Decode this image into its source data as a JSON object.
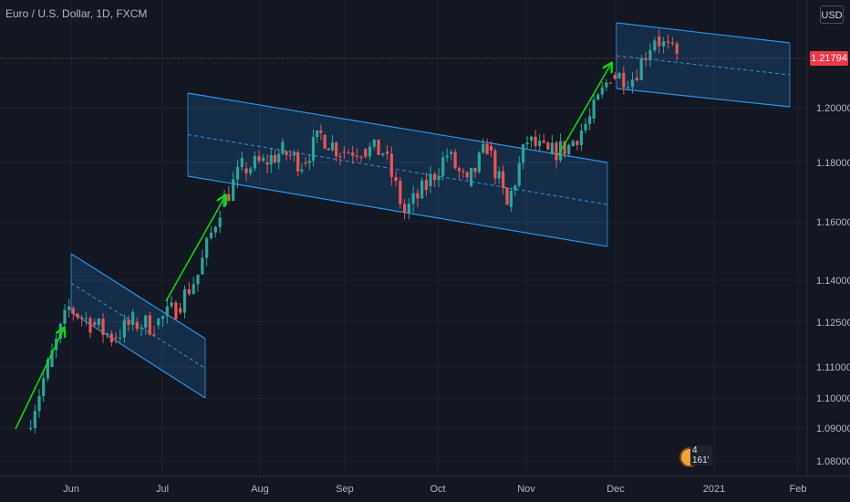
{
  "header": {
    "title": "Euro / U.S. Dollar, 1D, FXCM",
    "currency_button": "USD"
  },
  "price_label": {
    "value": "1.21794",
    "color": "#f23645"
  },
  "badge": {
    "text": "4 161'"
  },
  "colors": {
    "background": "#131722",
    "up": "#26a69a",
    "down": "#ef5350",
    "channel": "#2196f3",
    "arrow": "#00e600",
    "axis_text": "#b2b5be"
  },
  "chart_data": {
    "type": "candlestick",
    "title": "Euro / U.S. Dollar, 1D, FXCM",
    "x_tick_labels": [
      "Jun",
      "Jul",
      "Aug",
      "Sep",
      "Oct",
      "Nov",
      "Dec",
      "2021",
      "Feb"
    ],
    "y_tick_labels": [
      "1.20000",
      "1.18000",
      "1.16000",
      "1.14000",
      "1.12500",
      "1.11000",
      "1.10000",
      "1.09000",
      "1.08000"
    ],
    "last_price": 1.21794,
    "grid": true,
    "series": [
      {
        "name": "EURUSD",
        "points": [
          {
            "date": "2020-05-18",
            "close": 1.09
          },
          {
            "date": "2020-05-25",
            "close": 1.11
          },
          {
            "date": "2020-06-01",
            "close": 1.13
          },
          {
            "date": "2020-06-08",
            "close": 1.125
          },
          {
            "date": "2020-06-15",
            "close": 1.12
          },
          {
            "date": "2020-06-22",
            "close": 1.125
          },
          {
            "date": "2020-06-29",
            "close": 1.124
          },
          {
            "date": "2020-07-06",
            "close": 1.13
          },
          {
            "date": "2020-07-13",
            "close": 1.142
          },
          {
            "date": "2020-07-20",
            "close": 1.165
          },
          {
            "date": "2020-07-27",
            "close": 1.178
          },
          {
            "date": "2020-08-03",
            "close": 1.18
          },
          {
            "date": "2020-08-10",
            "close": 1.184
          },
          {
            "date": "2020-08-17",
            "close": 1.18
          },
          {
            "date": "2020-08-24",
            "close": 1.19
          },
          {
            "date": "2020-08-31",
            "close": 1.184
          },
          {
            "date": "2020-09-07",
            "close": 1.185
          },
          {
            "date": "2020-09-14",
            "close": 1.184
          },
          {
            "date": "2020-09-21",
            "close": 1.163
          },
          {
            "date": "2020-09-28",
            "close": 1.172
          },
          {
            "date": "2020-10-05",
            "close": 1.183
          },
          {
            "date": "2020-10-12",
            "close": 1.172
          },
          {
            "date": "2020-10-19",
            "close": 1.186
          },
          {
            "date": "2020-10-26",
            "close": 1.165
          },
          {
            "date": "2020-11-02",
            "close": 1.188
          },
          {
            "date": "2020-11-09",
            "close": 1.183
          },
          {
            "date": "2020-11-16",
            "close": 1.186
          },
          {
            "date": "2020-11-23",
            "close": 1.196
          },
          {
            "date": "2020-11-30",
            "close": 1.212
          },
          {
            "date": "2020-12-07",
            "close": 1.211
          },
          {
            "date": "2020-12-14",
            "close": 1.226
          },
          {
            "date": "2020-12-21",
            "close": 1.218
          }
        ]
      }
    ]
  }
}
